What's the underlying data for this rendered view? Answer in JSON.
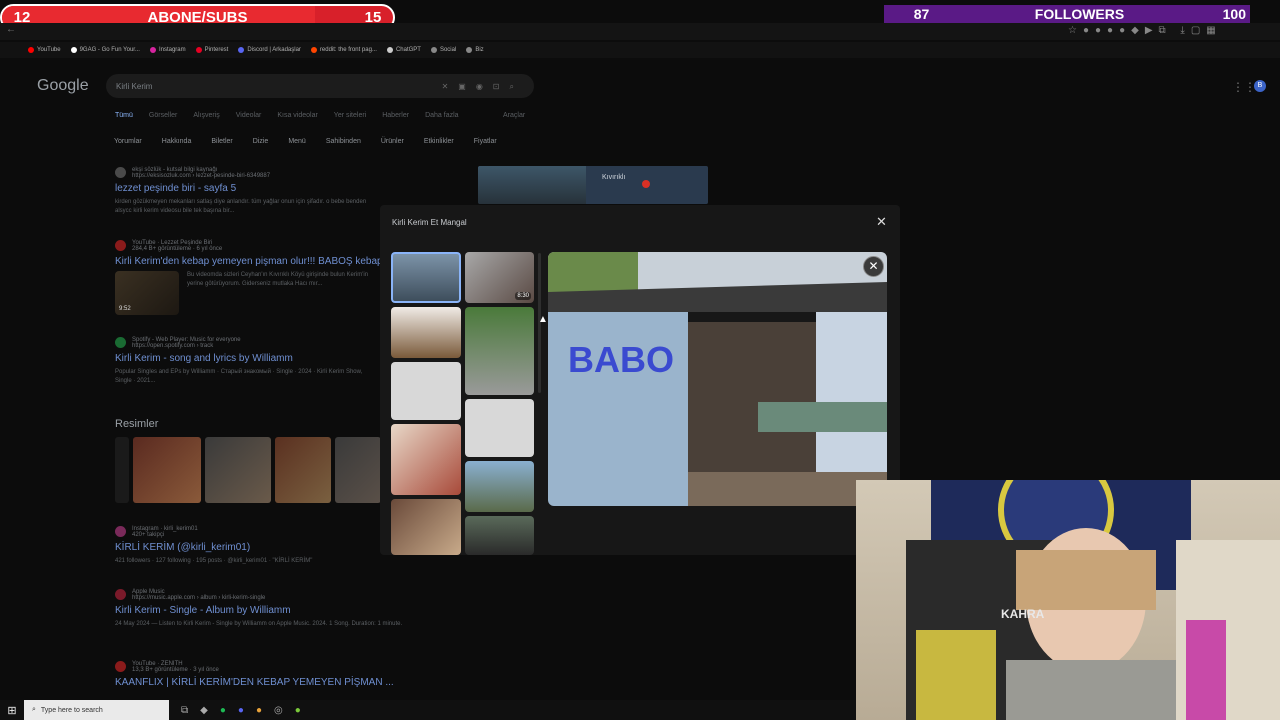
{
  "overlay": {
    "subs_left": "12",
    "subs_label": "ABONE/SUBS",
    "subs_right": "15",
    "subs_progress_fraction": 0.8,
    "followers_left": "87",
    "followers_label": "FOLLOWERS",
    "followers_right": "100"
  },
  "bookmarks": [
    {
      "label": "YouTube",
      "color": "#ff0000"
    },
    {
      "label": "9GAG - Go Fun Your...",
      "color": "#ffffff"
    },
    {
      "label": "Instagram",
      "color": "#d6249f"
    },
    {
      "label": "Pinterest",
      "color": "#e60023"
    },
    {
      "label": "Discord | Arkadaşlar",
      "color": "#5865f2"
    },
    {
      "label": "reddit: the front pag...",
      "color": "#ff4500"
    },
    {
      "label": "ChatGPT",
      "color": "#cccccc"
    },
    {
      "label": "Social",
      "color": "#888888"
    },
    {
      "label": "Biz",
      "color": "#888888"
    }
  ],
  "google": {
    "logo": "Google",
    "query": "Kirli Kerim",
    "tabs": [
      "Tümü",
      "Görseller",
      "Alışveriş",
      "Videolar",
      "Kısa videolar",
      "Yer siteleri",
      "Haberler",
      "Daha fazla"
    ],
    "tools": "Araçlar",
    "chips": [
      "Yorumlar",
      "Hakkında",
      "Biletler",
      "Dizie",
      "Menü",
      "Sahibinden",
      "Ürünler",
      "Etkinlikler",
      "Fiyatlar"
    ],
    "map_label": "Kıvırıklı",
    "avatar": "B",
    "results": [
      {
        "source": "ekşi sözlük - kutsal bilgi kaynağı",
        "url": "https://eksisozluk.com › lezzet-pesinde-biri-6349887",
        "title": "lezzet peşinde biri - sayfa 5",
        "snippet": "kirden gözükmeyen mekanları satlaş diye anlandır. tüm yağlar onun için şifadır. o bebe benden alsycc kirli kerim videosu bile tek başına bir..."
      },
      {
        "source": "YouTube · Lezzet Peşinde Biri",
        "url": "284,4 B+ görüntüleme · 6 yıl önce",
        "title": "Kirli Kerim'den kebap yemeyen pişman olur!!! BABOŞ kebap",
        "snippet": "Bu videomda sizleri Ceyhan'ın Kıvırıklı Köyü girişinde bulun Kerim'in yerine götürüyorum. Giderseniz mutlaka Hacı mır..."
      },
      {
        "source": "Spotify - Web Player: Music for everyone",
        "url": "https://open.spotify.com › track",
        "title": "Kirli Kerim - song and lyrics by Williamm",
        "snippet": "Popular Singles and EPs by Williamm · Старый знакомый · Single · 2024 · Kirli Kerim Show, Single · 2021..."
      },
      {
        "source": "Instagram · kirli_kerim01",
        "url": "420+ takipçi",
        "title": "KİRLİ KERİM (@kirli_kerim01)",
        "snippet": "421 followers · 127 following · 195 posts · @kirli_kerim01 · \"KİRLİ KERİM\""
      },
      {
        "source": "Apple Music",
        "url": "https://music.apple.com › album › kirli-kerim-single",
        "title": "Kirli Kerim - Single - Album by Williamm",
        "snippet": "24 May 2024 — Listen to Kirli Kerim - Single by Williamm on Apple Music. 2024. 1 Song. Duration: 1 minute."
      },
      {
        "source": "YouTube · ZENITH",
        "url": "13,3 B+ görüntüleme · 3 yıl önce",
        "title": "KAANFLIX | KİRLİ KERİM'DEN KEBAP YEMEYEN PİŞMAN ...",
        "snippet": ""
      }
    ],
    "images_heading": "Resimler",
    "video_duration": "9:52"
  },
  "modal": {
    "title": "Kirli Kerim Et Mangal",
    "video_badge": "8:30"
  },
  "webcam": {
    "chair_text": "KAHRA"
  },
  "taskbar": {
    "search_placeholder": "Type here to search"
  }
}
